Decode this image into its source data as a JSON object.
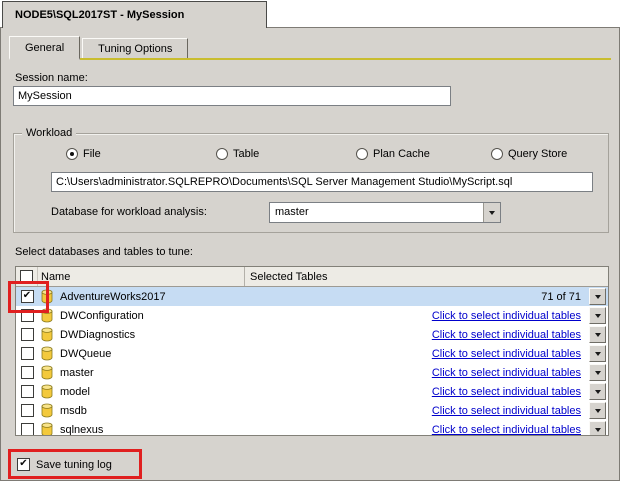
{
  "window": {
    "title": "NODE5\\SQL2017ST - MySession"
  },
  "tabs": {
    "general": "General",
    "tuning_options": "Tuning Options"
  },
  "session": {
    "label": "Session name:",
    "value": "MySession"
  },
  "workload": {
    "group_label": "Workload",
    "options": [
      {
        "label": "File",
        "selected": true
      },
      {
        "label": "Table",
        "selected": false
      },
      {
        "label": "Plan Cache",
        "selected": false
      },
      {
        "label": "Query Store",
        "selected": false
      }
    ],
    "file_path": "C:\\Users\\administrator.SQLREPRO\\Documents\\SQL Server Management Studio\\MyScript.sql",
    "database_label": "Database for workload analysis:",
    "database_value": "master"
  },
  "tune": {
    "label": "Select databases and tables to tune:",
    "columns": {
      "name": "Name",
      "selected_tables": "Selected Tables"
    },
    "rows": [
      {
        "name": "AdventureWorks2017",
        "checked": true,
        "highlighted": true,
        "selected_tables": "71 of 71",
        "is_link": false
      },
      {
        "name": "DWConfiguration",
        "checked": false,
        "highlighted": false,
        "selected_tables": "Click to select individual tables",
        "is_link": true
      },
      {
        "name": "DWDiagnostics",
        "checked": false,
        "highlighted": false,
        "selected_tables": "Click to select individual tables",
        "is_link": true
      },
      {
        "name": "DWQueue",
        "checked": false,
        "highlighted": false,
        "selected_tables": "Click to select individual tables",
        "is_link": true
      },
      {
        "name": "master",
        "checked": false,
        "highlighted": false,
        "selected_tables": "Click to select individual tables",
        "is_link": true
      },
      {
        "name": "model",
        "checked": false,
        "highlighted": false,
        "selected_tables": "Click to select individual tables",
        "is_link": true
      },
      {
        "name": "msdb",
        "checked": false,
        "highlighted": false,
        "selected_tables": "Click to select individual tables",
        "is_link": true
      },
      {
        "name": "sqlnexus",
        "checked": false,
        "highlighted": false,
        "selected_tables": "Click to select individual tables",
        "is_link": true
      }
    ]
  },
  "footer": {
    "save_label": "Save tuning log",
    "checked": true
  },
  "colors": {
    "highlight_red": "#e01f1f",
    "tab_accent": "#c9bd2f",
    "link_blue": "#0000cc",
    "selection_blue": "#c6dcf3"
  }
}
